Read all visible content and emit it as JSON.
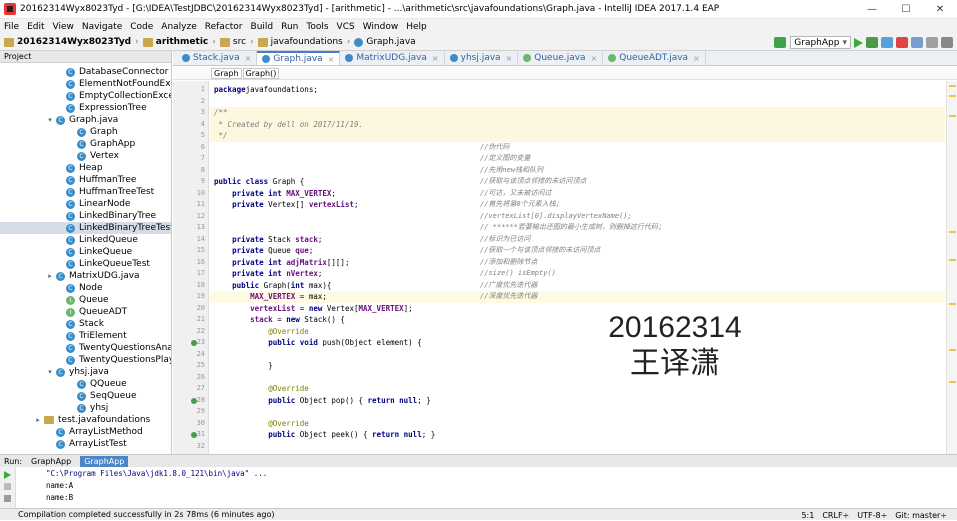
{
  "window": {
    "title": "20162314Wyx8023Tyd - [G:\\IDEA\\TestJDBC\\20162314Wyx8023Tyd] - [arithmetic] - ...\\arithmetic\\src\\javafoundations\\Graph.java - IntelliJ IDEA 2017.1.4 EAP",
    "minimize": "—",
    "maximize": "☐",
    "close": "✕"
  },
  "menu": [
    "File",
    "Edit",
    "View",
    "Navigate",
    "Code",
    "Analyze",
    "Refactor",
    "Build",
    "Run",
    "Tools",
    "VCS",
    "Window",
    "Help"
  ],
  "breadcrumb": [
    "20162314Wyx8023Tyd",
    "arithmetic",
    "src",
    "javafoundations",
    "Graph.java"
  ],
  "toolbar": {
    "run_config": "GraphApp"
  },
  "project": {
    "header": "Project",
    "items": [
      {
        "label": "DatabaseConnector",
        "icon": "c",
        "indent": 66
      },
      {
        "label": "ElementNotFoundException",
        "icon": "c",
        "indent": 66
      },
      {
        "label": "EmptyCollectionException",
        "icon": "c",
        "indent": 66
      },
      {
        "label": "ExpressionTree",
        "icon": "c",
        "indent": 66
      },
      {
        "label": "Graph.java",
        "icon": "c",
        "indent": 56,
        "toggle": "▾"
      },
      {
        "label": "Graph",
        "icon": "c",
        "indent": 77
      },
      {
        "label": "GraphApp",
        "icon": "c",
        "indent": 77
      },
      {
        "label": "Vertex",
        "icon": "c",
        "indent": 77
      },
      {
        "label": "Heap",
        "icon": "c",
        "indent": 66
      },
      {
        "label": "HuffmanTree",
        "icon": "c",
        "indent": 66
      },
      {
        "label": "HuffmanTreeTest",
        "icon": "c",
        "indent": 66
      },
      {
        "label": "LinearNode",
        "icon": "c",
        "indent": 66
      },
      {
        "label": "LinkedBinaryTree",
        "icon": "c",
        "indent": 66
      },
      {
        "label": "LinkedBinaryTreeTest",
        "icon": "c",
        "indent": 66,
        "selected": true
      },
      {
        "label": "LinkedQueue",
        "icon": "c",
        "indent": 66
      },
      {
        "label": "LinkeQueue",
        "icon": "c",
        "indent": 66
      },
      {
        "label": "LinkeQueueTest",
        "icon": "c",
        "indent": 66
      },
      {
        "label": "MatrixUDG.java",
        "icon": "c",
        "indent": 56,
        "toggle": "▸"
      },
      {
        "label": "Node",
        "icon": "c",
        "indent": 66
      },
      {
        "label": "Queue",
        "icon": "i",
        "indent": 66
      },
      {
        "label": "QueueADT",
        "icon": "i",
        "indent": 66
      },
      {
        "label": "Stack",
        "icon": "c",
        "indent": 66
      },
      {
        "label": "TriElement",
        "icon": "c",
        "indent": 66
      },
      {
        "label": "TwentyQuestionsAnalyzer",
        "icon": "c",
        "indent": 66
      },
      {
        "label": "TwentyQuestionsPlayer",
        "icon": "c",
        "indent": 66
      },
      {
        "label": "yhsj.java",
        "icon": "c",
        "indent": 56,
        "toggle": "▾"
      },
      {
        "label": "QQueue",
        "icon": "c",
        "indent": 77
      },
      {
        "label": "SeqQueue",
        "icon": "c",
        "indent": 77
      },
      {
        "label": "yhsj",
        "icon": "c",
        "indent": 77
      },
      {
        "label": "test.javafoundations",
        "icon": "pk",
        "indent": 44,
        "toggle": "▸"
      },
      {
        "label": "ArrayListMethod",
        "icon": "c",
        "indent": 56
      },
      {
        "label": "ArrayListTest",
        "icon": "c",
        "indent": 56
      }
    ]
  },
  "tabs": [
    {
      "label": "Stack.java"
    },
    {
      "label": "Graph.java",
      "active": true
    },
    {
      "label": "MatrixUDG.java"
    },
    {
      "label": "yhsj.java"
    },
    {
      "label": "Queue.java"
    },
    {
      "label": "QueueADT.java"
    }
  ],
  "editor_crumbs": [
    "Graph",
    "Graph()"
  ],
  "code": {
    "line_numbers": [
      "1",
      "2",
      "3",
      "4",
      "5",
      "6",
      "7",
      "8",
      "9",
      "10",
      "11",
      "12",
      "13",
      "14",
      "15",
      "16",
      "17",
      "18",
      "19",
      "20",
      "21",
      "22",
      "23",
      "24",
      "25",
      "26",
      "27",
      "28",
      "29",
      "30",
      "31",
      "32"
    ],
    "lines": [
      [
        [
          "kw",
          "package"
        ],
        [
          "",
          "javafoundations;"
        ]
      ],
      [],
      [
        [
          "cm",
          "/**"
        ]
      ],
      [
        [
          "cm",
          " * Created by dell on 2017/11/19."
        ]
      ],
      [
        [
          "cm",
          " */"
        ]
      ],
      [],
      [],
      [],
      [
        [
          "kw",
          "public class"
        ],
        [
          "",
          " Graph {"
        ]
      ],
      [
        [
          "",
          "    "
        ],
        [
          "kw",
          "private int"
        ],
        [
          "",
          " "
        ],
        [
          "fld",
          "MAX_VERTEX"
        ],
        [
          "",
          ";"
        ]
      ],
      [
        [
          "",
          "    "
        ],
        [
          "kw",
          "private"
        ],
        [
          "",
          " Vertex[] "
        ],
        [
          "fld",
          "vertexList"
        ],
        [
          "",
          ";"
        ]
      ],
      [],
      [],
      [
        [
          "",
          "    "
        ],
        [
          "kw",
          "private"
        ],
        [
          "",
          " Stack "
        ],
        [
          "fld",
          "stack"
        ],
        [
          "",
          ";"
        ]
      ],
      [
        [
          "",
          "    "
        ],
        [
          "kw",
          "private"
        ],
        [
          "",
          " Queue "
        ],
        [
          "fld",
          "que"
        ],
        [
          "",
          ";"
        ]
      ],
      [
        [
          "",
          "    "
        ],
        [
          "kw",
          "private int"
        ],
        [
          "",
          " "
        ],
        [
          "fld",
          "adjMatrix"
        ],
        [
          "",
          "[][];"
        ]
      ],
      [
        [
          "",
          "    "
        ],
        [
          "kw",
          "private int"
        ],
        [
          "",
          " "
        ],
        [
          "fld",
          "nVertex"
        ],
        [
          "",
          ";"
        ]
      ],
      [
        [
          "",
          "    "
        ],
        [
          "kw",
          "public"
        ],
        [
          "",
          " Graph("
        ],
        [
          "kw",
          "int"
        ],
        [
          "",
          " max){"
        ]
      ],
      [
        [
          "",
          "        "
        ],
        [
          "fld",
          "MAX_VERTEX"
        ],
        [
          "",
          " = max;"
        ]
      ],
      [
        [
          "",
          "        "
        ],
        [
          "fld",
          "vertexList"
        ],
        [
          "",
          " = "
        ],
        [
          "kw",
          "new"
        ],
        [
          "",
          " Vertex["
        ],
        [
          "fld",
          "MAX_VERTEX"
        ],
        [
          "",
          "];"
        ]
      ],
      [
        [
          "",
          "        "
        ],
        [
          "fld",
          "stack"
        ],
        [
          "",
          " = "
        ],
        [
          "kw",
          "new"
        ],
        [
          "",
          " Stack() {"
        ]
      ],
      [
        [
          "",
          "            "
        ],
        [
          "an",
          "@Override"
        ]
      ],
      [
        [
          "",
          "            "
        ],
        [
          "kw",
          "public void"
        ],
        [
          "",
          " push(Object element) {"
        ]
      ],
      [],
      [
        [
          "",
          "            }"
        ]
      ],
      [],
      [
        [
          "",
          "            "
        ],
        [
          "an",
          "@Override"
        ]
      ],
      [
        [
          "",
          "            "
        ],
        [
          "kw",
          "public"
        ],
        [
          "",
          " Object pop() { "
        ],
        [
          "kw",
          "return null"
        ],
        [
          "",
          "; }"
        ]
      ],
      [],
      [
        [
          "",
          "            "
        ],
        [
          "an",
          "@Override"
        ]
      ],
      [
        [
          "",
          "            "
        ],
        [
          "kw",
          "public"
        ],
        [
          "",
          " Object peek() { "
        ],
        [
          "kw",
          "return null"
        ],
        [
          "",
          "; }"
        ]
      ],
      []
    ],
    "side_comments": [
      {
        "row": 5,
        "text": "//伪代码"
      },
      {
        "row": 6,
        "text": "//定义图的变量"
      },
      {
        "row": 7,
        "text": "//先用new栈和队列"
      },
      {
        "row": 8,
        "text": "//获取与该顶点邻接的未访问顶点"
      },
      {
        "row": 9,
        "text": "//可达，又未被访问过"
      },
      {
        "row": 10,
        "text": "//首先将第0个元素入栈；"
      },
      {
        "row": 11,
        "text": "//vertexList[0].displayVertexName();"
      },
      {
        "row": 12,
        "text": "// ******若要输出还图的最小生成树，则删掉这行代码；"
      },
      {
        "row": 13,
        "text": "//标识为已访问"
      },
      {
        "row": 14,
        "text": "//获取一个与该顶点邻接的未访问顶点"
      },
      {
        "row": 15,
        "text": "//添加和删除节点"
      },
      {
        "row": 16,
        "text": "//size() isEmpty()"
      },
      {
        "row": 17,
        "text": "//广度优先迭代器"
      },
      {
        "row": 18,
        "text": "//深度优先迭代器"
      }
    ]
  },
  "watermark": {
    "line1": "20162314",
    "line2": "王译潇"
  },
  "run": {
    "label": "Run:",
    "tabs": [
      {
        "label": "GraphApp"
      },
      {
        "label": "GraphApp",
        "active": true
      }
    ],
    "console": [
      "\"C:\\Program Files\\Java\\jdk1.8.0_121\\bin\\java\" ...",
      "name:A",
      "name:B"
    ]
  },
  "status": {
    "message": "Compilation completed successfully in 2s 78ms (6 minutes ago)",
    "position": "5:1",
    "line_sep": "CRLF÷",
    "encoding": "UTF-8÷",
    "vcs": "Git: master÷"
  }
}
